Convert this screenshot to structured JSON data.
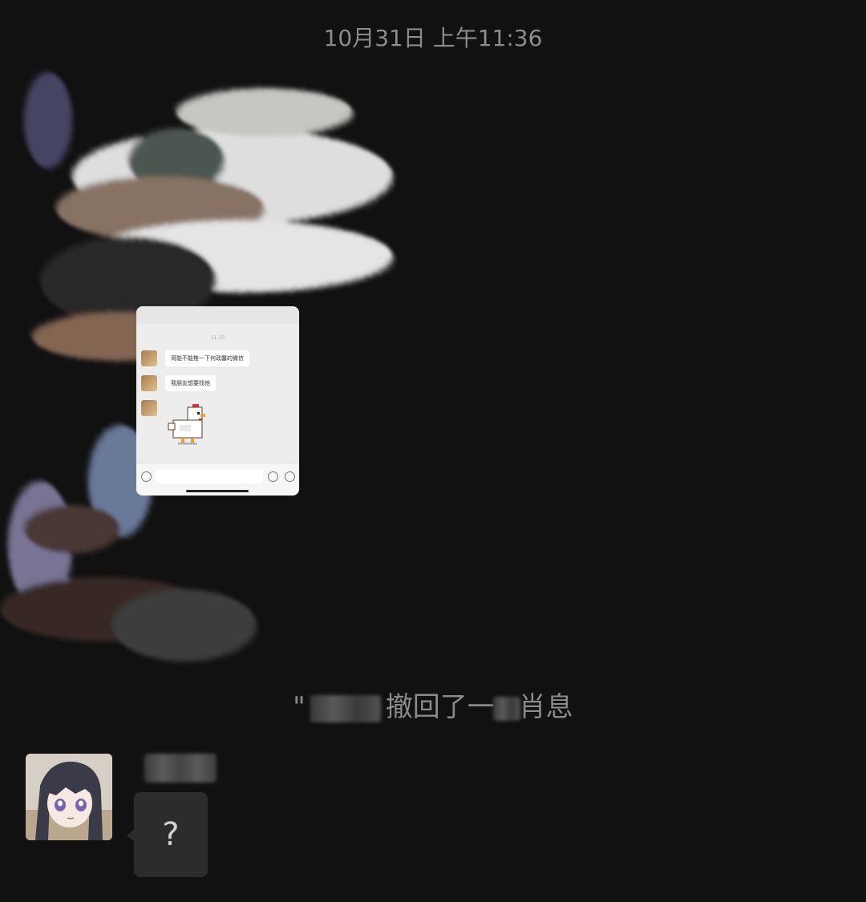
{
  "timestamp": "10月31日 上午11:36",
  "embedded_screenshot": {
    "time": "11:33",
    "messages": [
      "哥能不能推一下何政馨的微信",
      "我朋友想要找他"
    ],
    "sticker": "chicken-sticker"
  },
  "recall_notice": {
    "prefix": "\"",
    "part1": "撤回了一",
    "part2": "肖息"
  },
  "last_message": {
    "text": "?"
  },
  "colors": {
    "background": "#111111",
    "bubble": "#2c2c2c",
    "muted_text": "#8c8c8c"
  }
}
